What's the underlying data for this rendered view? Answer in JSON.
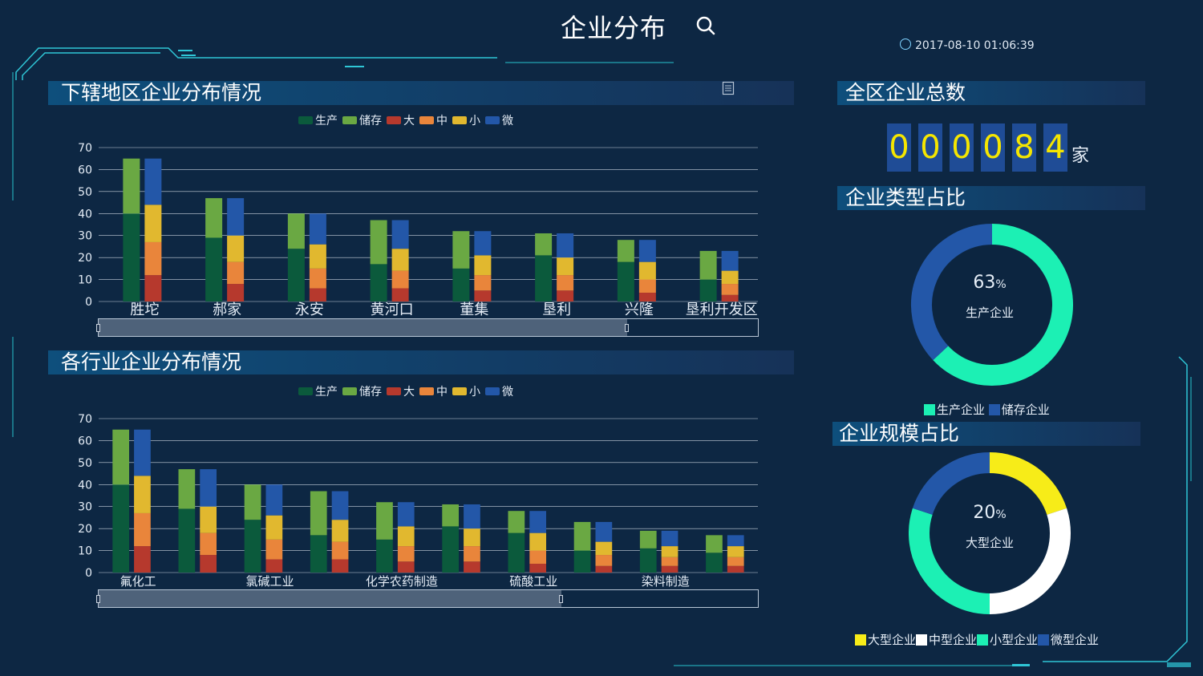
{
  "header": {
    "title": "企业分布",
    "datetime": "2017-08-10 01:06:39"
  },
  "colors": {
    "production": "#0b5a3c",
    "storage": "#6aa843",
    "large": "#b6392d",
    "medium": "#e9853b",
    "small": "#e1b82f",
    "micro": "#2357a8",
    "teal": "#1cf0b4",
    "yellow": "#f7ec18",
    "white": "#ffffff",
    "blue": "#2357a8"
  },
  "legend_labels": [
    "生产",
    "储存",
    "大",
    "中",
    "小",
    "微"
  ],
  "chart1": {
    "title": "下辖地区企业分布情况",
    "chart_data": {
      "type": "bar",
      "categories": [
        "胜坨",
        "郝家",
        "永安",
        "黄河口",
        "董集",
        "垦利",
        "兴隆",
        "垦利开发区"
      ],
      "ylim": [
        0,
        70
      ],
      "yticks": [
        0,
        10,
        20,
        30,
        40,
        50,
        60,
        70
      ],
      "series": [
        {
          "name": "生产",
          "stack": "type",
          "values": [
            40,
            29,
            24,
            17,
            15,
            21,
            18,
            10
          ]
        },
        {
          "name": "储存",
          "stack": "type",
          "values": [
            25,
            18,
            16,
            20,
            17,
            10,
            10,
            13
          ]
        },
        {
          "name": "大",
          "stack": "size",
          "values": [
            12,
            8,
            6,
            6,
            5,
            5,
            4,
            3
          ]
        },
        {
          "name": "中",
          "stack": "size",
          "values": [
            15,
            10,
            9,
            8,
            7,
            7,
            6,
            5
          ]
        },
        {
          "name": "小",
          "stack": "size",
          "values": [
            17,
            12,
            11,
            10,
            9,
            8,
            8,
            6
          ]
        },
        {
          "name": "微",
          "stack": "size",
          "values": [
            21,
            17,
            14,
            13,
            11,
            11,
            10,
            9
          ]
        }
      ],
      "zoom_end": 0.8
    }
  },
  "chart2": {
    "title": "各行业企业分布情况",
    "chart_data": {
      "type": "bar",
      "categories": [
        "氟化工",
        "",
        "氯碱工业",
        "",
        "化学农药制造",
        "",
        "硫酸工业",
        "",
        "染料制造",
        ""
      ],
      "ylim": [
        0,
        70
      ],
      "yticks": [
        0,
        10,
        20,
        30,
        40,
        50,
        60,
        70
      ],
      "series": [
        {
          "name": "生产",
          "stack": "type",
          "values": [
            40,
            29,
            24,
            17,
            15,
            21,
            18,
            10,
            11,
            9
          ]
        },
        {
          "name": "储存",
          "stack": "type",
          "values": [
            25,
            18,
            16,
            20,
            17,
            10,
            10,
            13,
            8,
            8
          ]
        },
        {
          "name": "大",
          "stack": "size",
          "values": [
            12,
            8,
            6,
            6,
            5,
            5,
            4,
            3,
            3,
            3
          ]
        },
        {
          "name": "中",
          "stack": "size",
          "values": [
            15,
            10,
            9,
            8,
            7,
            7,
            6,
            5,
            4,
            4
          ]
        },
        {
          "name": "小",
          "stack": "size",
          "values": [
            17,
            12,
            11,
            10,
            9,
            8,
            8,
            6,
            5,
            5
          ]
        },
        {
          "name": "微",
          "stack": "size",
          "values": [
            21,
            17,
            14,
            13,
            11,
            11,
            10,
            9,
            7,
            5
          ]
        }
      ],
      "zoom_end": 0.7
    }
  },
  "total": {
    "title": "全区企业总数",
    "digits": [
      "0",
      "0",
      "0",
      "0",
      "8",
      "4"
    ],
    "unit": "家"
  },
  "type_ratio": {
    "title": "企业类型占比",
    "center_pct": "63",
    "pct_sign": "%",
    "center_label": "生产企业",
    "chart_data": {
      "type": "pie",
      "labels": [
        "生产企业",
        "储存企业"
      ],
      "values": [
        63,
        37
      ]
    },
    "legend": [
      "生产企业",
      "储存企业"
    ]
  },
  "size_ratio": {
    "title": "企业规模占比",
    "center_pct": "20",
    "pct_sign": "%",
    "center_label": "大型企业",
    "chart_data": {
      "type": "pie",
      "labels": [
        "大型企业",
        "中型企业",
        "小型企业",
        "微型企业"
      ],
      "values": [
        20,
        30,
        30,
        20
      ]
    },
    "legend": [
      "大型企业",
      "中型企业",
      "小型企业",
      "微型企业"
    ]
  }
}
